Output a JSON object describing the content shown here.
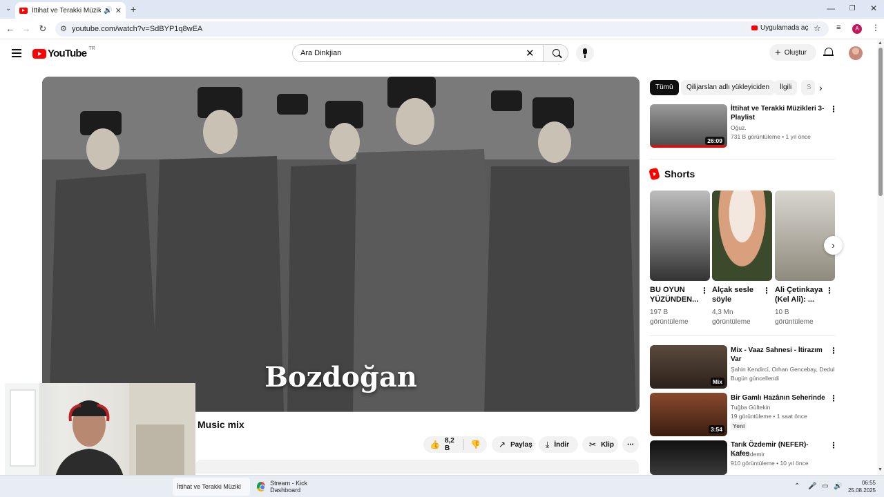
{
  "browser": {
    "tab_title": "İttihat ve Terakki Müzikleri",
    "tab_icons": [
      "youtube-favicon",
      "speaker-icon",
      "close-icon"
    ],
    "url": "youtube.com/watch?v=SdBYP1q8wEA",
    "open_in_app": "Uygulamada aç",
    "profile_initial": "A"
  },
  "youtube": {
    "logo_text": "YouTube",
    "country_code": "TR",
    "search_query": "Ara Dinkjian",
    "create_label": "Oluştur"
  },
  "player": {
    "caption": "Bozdoğan"
  },
  "video": {
    "title": "Music mix",
    "likes": "8,2 B",
    "share": "Paylaş",
    "download": "İndir",
    "clip": "Klip"
  },
  "chips": [
    "Tümü",
    "Qilijarslan adlı yükleyiciden",
    "İlgili",
    "S"
  ],
  "related_top": {
    "title": "İttihat ve Terakki Müzikleri 3- Playlist",
    "channel": "Oğuz.",
    "meta": "731 B görüntüleme • 1 yıl önce",
    "duration": "26:09"
  },
  "shorts": {
    "header": "Shorts",
    "items": [
      {
        "title": "BU OYUN YÜZÜNDEN...",
        "views": "197 B görüntüleme"
      },
      {
        "title": "Alçak sesle söyle",
        "views": "4,3 Mn görüntüleme"
      },
      {
        "title": "Ali Çetinkaya (Kel Ali): ...",
        "views": "10 B görüntüleme"
      }
    ]
  },
  "related": [
    {
      "title": "Mix - Vaaz Sahnesi - İtirazım Var",
      "channel": "Şahin Kendirci, Orhan Gencebay, Dedubluman ve daha fazlası",
      "meta": "Bugün güncellendi",
      "duration": "Mix",
      "badge": ""
    },
    {
      "title": "Bir Gamlı Hazânın Seherinde",
      "channel": "Tuğba Gültekin",
      "meta": "19 görüntüleme • 1 saat önce",
      "duration": "3:54",
      "badge": "Yeni"
    },
    {
      "title": "Tarık Özdemir (NEFER)- Kafes",
      "channel": "tarık özdemir",
      "meta": "910 görüntüleme • 10 yıl önce",
      "duration": "",
      "badge": ""
    }
  ],
  "taskbar": {
    "items": [
      "İttihat ve Terakki Müzikl",
      "Stream - Kick Dashboard"
    ],
    "time": "06:55",
    "date": "25.08.2025"
  }
}
